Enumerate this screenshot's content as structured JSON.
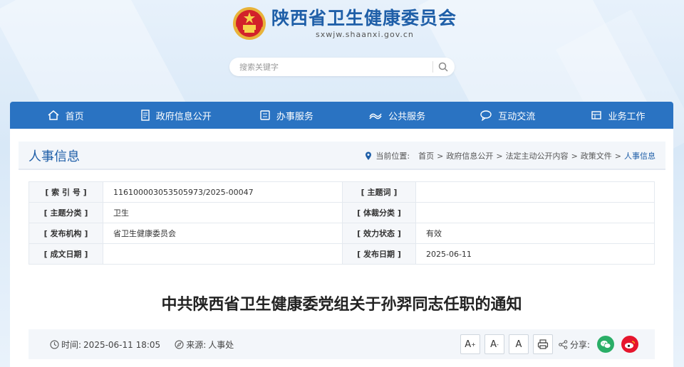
{
  "header": {
    "site_title": "陕西省卫生健康委员会",
    "site_domain": "sxwjw.shaanxi.gov.cn",
    "emblem": "national-emblem-icon"
  },
  "search": {
    "placeholder": "搜索关键字",
    "icon": "search-icon"
  },
  "nav": {
    "items": [
      {
        "label": "首页",
        "icon": "home-icon"
      },
      {
        "label": "政府信息公开",
        "icon": "document-icon"
      },
      {
        "label": "办事服务",
        "icon": "service-icon"
      },
      {
        "label": "公共服务",
        "icon": "public-service-icon"
      },
      {
        "label": "互动交流",
        "icon": "chat-icon"
      },
      {
        "label": "业务工作",
        "icon": "work-icon"
      }
    ]
  },
  "section": {
    "title": "人事信息",
    "crumb_prefix": "当前位置:",
    "crumbs": [
      "首页",
      "政府信息公开",
      "法定主动公开内容",
      "政策文件",
      "人事信息"
    ]
  },
  "meta": {
    "rows": [
      {
        "k1": "[ 索 引 号 ]",
        "v1": "11610000305350597​3/2025-00047",
        "k2": "[ 主题词 ]",
        "v2": ""
      },
      {
        "k1": "[ 主题分类 ]",
        "v1": "卫生",
        "k2": "[ 体裁分类 ]",
        "v2": ""
      },
      {
        "k1": "[ 发布机构 ]",
        "v1": "省卫生健康委员会",
        "k2": "[ 效力状态 ]",
        "v2": "有效"
      },
      {
        "k1": "[ 成文日期 ]",
        "v1": "",
        "k2": "[ 发布日期 ]",
        "v2": "2025-06-11"
      }
    ]
  },
  "document": {
    "title": "中共陕西省卫生健康委党组关于孙羿同志任职的通知",
    "time_label": "时间:",
    "time_value": "2025-06-11 18:05",
    "source_label": "来源:",
    "source_value": "人事处"
  },
  "tools": {
    "font_large": "A",
    "font_small": "A",
    "font_normal": "A",
    "share_label": "分享:",
    "colors": {
      "wechat": "#2aae67",
      "weibo": "#e6162d",
      "brand": "#2a73c2"
    }
  }
}
